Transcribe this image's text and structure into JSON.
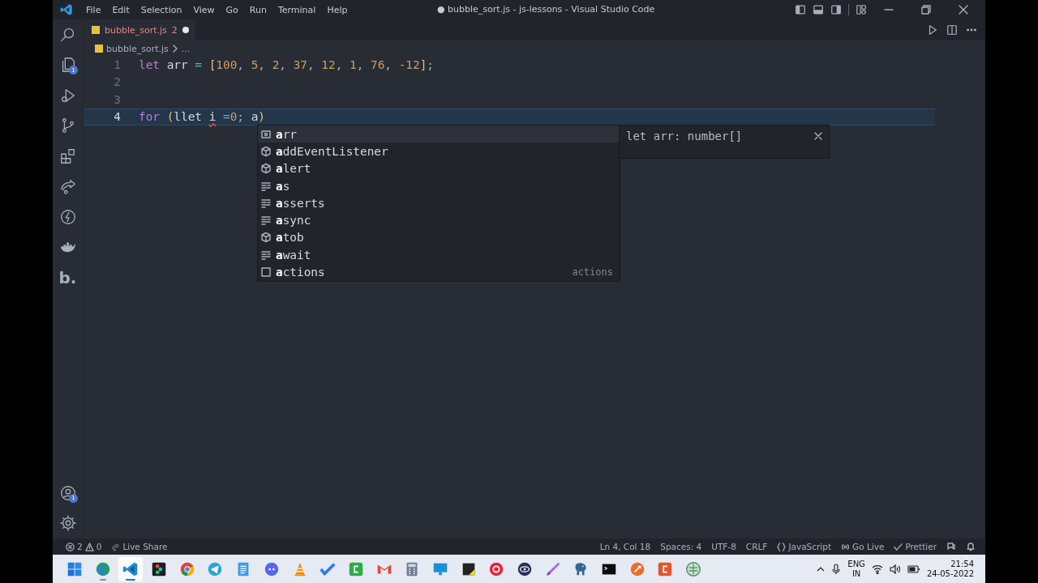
{
  "window": {
    "title": "● bubble_sort.js - js-lessons - Visual Studio Code"
  },
  "menu": [
    "File",
    "Edit",
    "Selection",
    "View",
    "Go",
    "Run",
    "Terminal",
    "Help"
  ],
  "activity_bar": {
    "top": [
      {
        "kind": "search"
      },
      {
        "kind": "explorer",
        "badge": "1"
      },
      {
        "kind": "debug"
      },
      {
        "kind": "source-control"
      },
      {
        "kind": "extensions"
      },
      {
        "kind": "live-share"
      },
      {
        "kind": "thunder"
      },
      {
        "kind": "docker"
      },
      {
        "kind": "logo",
        "label": "b."
      }
    ],
    "bottom": [
      {
        "kind": "account",
        "badge": "1"
      },
      {
        "kind": "settings"
      }
    ]
  },
  "tabs": [
    {
      "label": "bubble_sort.js",
      "problems": "2",
      "modified": true,
      "selected": true
    }
  ],
  "breadcrumb": [
    "bubble_sort.js",
    "..."
  ],
  "editor": {
    "lines": [
      {
        "number": "1",
        "current": false,
        "tokens": [
          {
            "text": "let",
            "kind": "keyword"
          },
          {
            "text": " arr ",
            "kind": "variable"
          },
          {
            "text": "=",
            "kind": "operator"
          },
          {
            "text": " [",
            "kind": "bracket"
          },
          {
            "text": "100",
            "kind": "number"
          },
          {
            "text": ", ",
            "kind": "punct"
          },
          {
            "text": "5",
            "kind": "number"
          },
          {
            "text": ", ",
            "kind": "punct"
          },
          {
            "text": "2",
            "kind": "number"
          },
          {
            "text": ", ",
            "kind": "punct"
          },
          {
            "text": "37",
            "kind": "number"
          },
          {
            "text": ", ",
            "kind": "punct"
          },
          {
            "text": "12",
            "kind": "number"
          },
          {
            "text": ", ",
            "kind": "punct"
          },
          {
            "text": "1",
            "kind": "number"
          },
          {
            "text": ", ",
            "kind": "punct"
          },
          {
            "text": "76",
            "kind": "number"
          },
          {
            "text": ", ",
            "kind": "punct"
          },
          {
            "text": "-12",
            "kind": "number"
          },
          {
            "text": "]",
            "kind": "bracket"
          },
          {
            "text": ";",
            "kind": "punct"
          }
        ]
      },
      {
        "number": "2",
        "current": false
      },
      {
        "number": "3",
        "current": false
      },
      {
        "number": "4",
        "current": true,
        "tokens": [
          {
            "text": "for",
            "kind": "keyword"
          },
          {
            "text": " (",
            "kind": "paren"
          },
          {
            "text": "llet ",
            "kind": "variable"
          },
          {
            "text": "i",
            "kind": "variable",
            "error": true
          },
          {
            "text": " =",
            "kind": "operator"
          },
          {
            "text": "0",
            "kind": "number"
          },
          {
            "text": "; ",
            "kind": "punct"
          },
          {
            "text": "a",
            "kind": "variable"
          },
          {
            "text": ")",
            "kind": "paren"
          }
        ]
      }
    ]
  },
  "suggest": {
    "items": [
      {
        "kind": "variable",
        "label": "**a**rr",
        "selected": true
      },
      {
        "kind": "method",
        "label": "**a**ddEventListener",
        "selected": false
      },
      {
        "kind": "method",
        "label": "**a**lert",
        "selected": false
      },
      {
        "kind": "keyword",
        "label": "**a**s",
        "selected": false
      },
      {
        "kind": "keyword",
        "label": "**a**sserts",
        "selected": false
      },
      {
        "kind": "keyword",
        "label": "**a**sync",
        "selected": false
      },
      {
        "kind": "method",
        "label": "**a**tob",
        "selected": false
      },
      {
        "kind": "keyword",
        "label": "**a**wait",
        "selected": false
      },
      {
        "kind": "snippet",
        "label": "**a**ctions",
        "detail": "actions",
        "selected": false
      }
    ],
    "details": {
      "text": "let arr: number[]"
    }
  },
  "status_bar": {
    "errors": "2",
    "warnings": "0",
    "live_share": "Live Share",
    "items": [
      "Ln 4, Col 18",
      "Spaces: 4",
      "UTF-8",
      "CRLF"
    ],
    "language": "JavaScript",
    "go_live": "Go Live",
    "prettier": "Prettier"
  },
  "taskbar": {
    "apps": [
      {
        "kind": "start",
        "running": false,
        "selected": false
      },
      {
        "kind": "edge",
        "running": true,
        "selected": false
      },
      {
        "kind": "vscode",
        "running": true,
        "selected": true
      },
      {
        "kind": "figma",
        "running": false,
        "selected": false
      },
      {
        "kind": "chrome",
        "running": false,
        "selected": false
      },
      {
        "kind": "telegram",
        "running": false,
        "selected": false
      },
      {
        "kind": "notepad",
        "running": false,
        "selected": false
      },
      {
        "kind": "discord",
        "running": false,
        "selected": false
      },
      {
        "kind": "vlc",
        "running": false,
        "selected": false
      },
      {
        "kind": "todo",
        "running": false,
        "selected": false
      },
      {
        "kind": "camtasia",
        "running": false,
        "selected": false
      },
      {
        "kind": "gmail",
        "running": false,
        "selected": false
      },
      {
        "kind": "calculator",
        "running": false,
        "selected": false
      },
      {
        "kind": "monitor",
        "running": false,
        "selected": false
      },
      {
        "kind": "sticky",
        "running": false,
        "selected": false
      },
      {
        "kind": "ring",
        "running": false,
        "selected": false
      },
      {
        "kind": "eye",
        "running": false,
        "selected": false
      },
      {
        "kind": "pen",
        "running": false,
        "selected": false
      },
      {
        "kind": "elephant",
        "running": false,
        "selected": false
      },
      {
        "kind": "terminal",
        "running": false,
        "selected": false
      },
      {
        "kind": "rocket",
        "running": false,
        "selected": false
      },
      {
        "kind": "recorder",
        "running": false,
        "selected": false
      },
      {
        "kind": "globe",
        "running": false,
        "selected": false
      }
    ],
    "language": [
      "ENG",
      "IN"
    ],
    "time": "21:54",
    "date": "24-05-2022"
  }
}
